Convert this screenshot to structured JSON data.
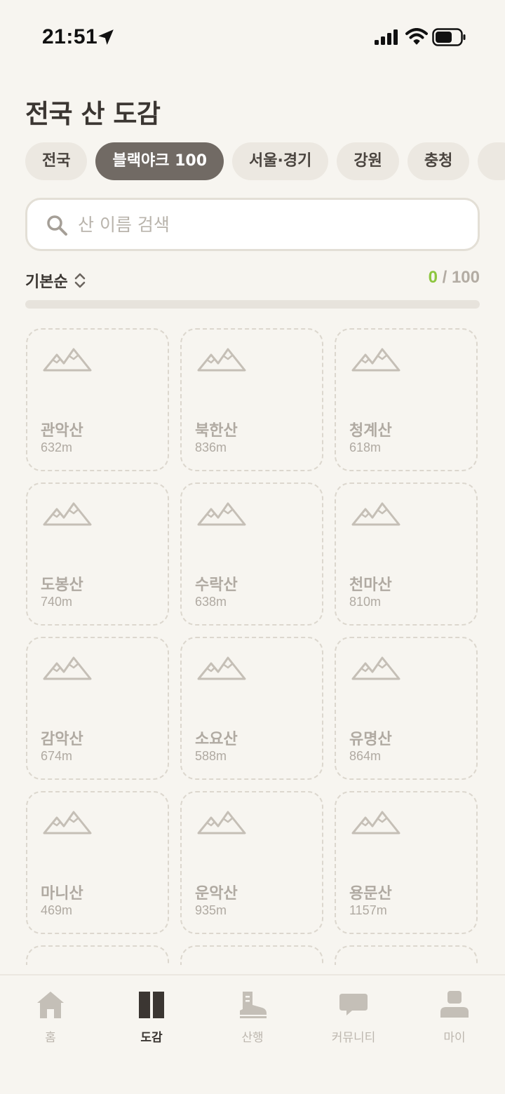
{
  "status": {
    "time": "21:51"
  },
  "title": "전국 산 도감",
  "chips": [
    {
      "label": "전국",
      "active": false
    },
    {
      "label": "블랙야크 100",
      "active": true
    },
    {
      "label": "서울·경기",
      "active": false
    },
    {
      "label": "강원",
      "active": false
    },
    {
      "label": "충청",
      "active": false
    },
    {
      "label": "",
      "active": false
    }
  ],
  "search": {
    "placeholder": "산 이름 검색",
    "value": ""
  },
  "sort": {
    "label": "기본순"
  },
  "progress": {
    "collected": "0",
    "separator": " / ",
    "total": "100",
    "fraction": 0
  },
  "mountains": [
    {
      "name": "관악산",
      "altitude": "632m"
    },
    {
      "name": "북한산",
      "altitude": "836m"
    },
    {
      "name": "청계산",
      "altitude": "618m"
    },
    {
      "name": "도봉산",
      "altitude": "740m"
    },
    {
      "name": "수락산",
      "altitude": "638m"
    },
    {
      "name": "천마산",
      "altitude": "810m"
    },
    {
      "name": "감악산",
      "altitude": "674m"
    },
    {
      "name": "소요산",
      "altitude": "588m"
    },
    {
      "name": "유명산",
      "altitude": "864m"
    },
    {
      "name": "마니산",
      "altitude": "469m"
    },
    {
      "name": "운악산",
      "altitude": "935m"
    },
    {
      "name": "용문산",
      "altitude": "1157m"
    },
    {
      "name": "",
      "altitude": ""
    },
    {
      "name": "",
      "altitude": ""
    },
    {
      "name": "",
      "altitude": ""
    }
  ],
  "tabs": [
    {
      "label": "홈",
      "icon": "home-icon",
      "active": false
    },
    {
      "label": "도감",
      "icon": "book-icon",
      "active": true
    },
    {
      "label": "산행",
      "icon": "boot-icon",
      "active": false
    },
    {
      "label": "커뮤니티",
      "icon": "chat-icon",
      "active": false
    },
    {
      "label": "마이",
      "icon": "person-icon",
      "active": false
    }
  ],
  "colors": {
    "accent": "#8dc63f",
    "chip_active": "#716a64",
    "background": "#f7f5f0"
  }
}
